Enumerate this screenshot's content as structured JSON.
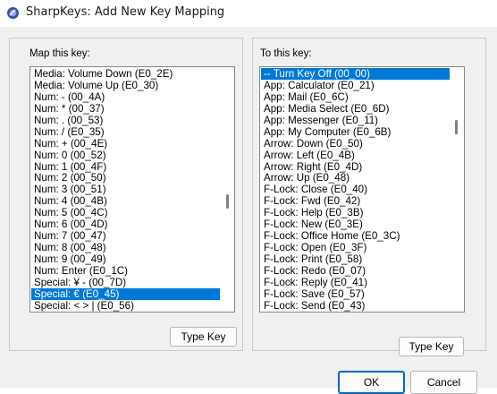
{
  "window": {
    "title": "SharpKeys: Add New Key Mapping",
    "icon": "sharpkeys-app-icon"
  },
  "left_panel": {
    "label": "Map this key:",
    "items": [
      "Media: Volume Down (E0_2E)",
      "Media: Volume Up (E0_30)",
      "Num: - (00_4A)",
      "Num: * (00_37)",
      "Num: . (00_53)",
      "Num: / (E0_35)",
      "Num: + (00_4E)",
      "Num: 0 (00_52)",
      "Num: 1 (00_4F)",
      "Num: 2 (00_50)",
      "Num: 3 (00_51)",
      "Num: 4 (00_4B)",
      "Num: 5 (00_4C)",
      "Num: 6 (00_4D)",
      "Num: 7 (00_47)",
      "Num: 8 (00_48)",
      "Num: 9 (00_49)",
      "Num: Enter (E0_1C)",
      "Special: ¥ - (00_7D)",
      "Special: € (E0_45)",
      "Special: < > | (E0_56)"
    ],
    "selected_index": 19,
    "type_key_button": "Type Key"
  },
  "right_panel": {
    "label": "To this key:",
    "items": [
      "-- Turn Key Off (00_00)",
      "App: Calculator (E0_21)",
      "App: Mail (E0_6C)",
      "App: Media Select (E0_6D)",
      "App: Messenger (E0_11)",
      "App: My Computer (E0_6B)",
      "Arrow: Down (E0_50)",
      "Arrow: Left (E0_4B)",
      "Arrow: Right (E0_4D)",
      "Arrow: Up (E0_48)",
      "F-Lock: Close (E0_40)",
      "F-Lock: Fwd (E0_42)",
      "F-Lock: Help (E0_3B)",
      "F-Lock: New (E0_3E)",
      "F-Lock: Office Home (E0_3C)",
      "F-Lock: Open (E0_3F)",
      "F-Lock: Print (E0_58)",
      "F-Lock: Redo (E0_07)",
      "F-Lock: Reply (E0_41)",
      "F-Lock: Save (E0_57)",
      "F-Lock: Send (E0_43)"
    ],
    "selected_index": 0,
    "type_key_button": "Type Key"
  },
  "footer": {
    "ok_button": "OK",
    "cancel_button": "Cancel"
  },
  "colors": {
    "selection": "#0078d7",
    "focus_border": "#0067c0"
  }
}
